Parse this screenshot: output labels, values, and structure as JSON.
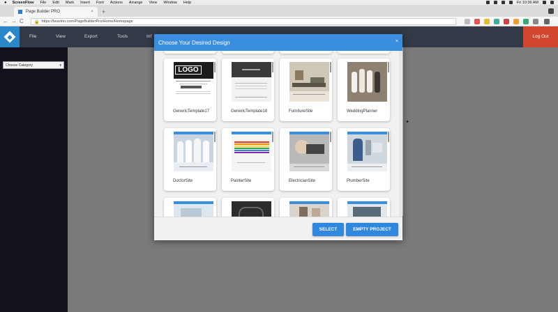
{
  "mac_menubar": {
    "apple": "",
    "app": "ScreenFlow",
    "items": [
      "File",
      "Edit",
      "Mark",
      "Insert",
      "Font",
      "Actions",
      "Arrange",
      "View",
      "Window",
      "Help"
    ],
    "clock": "Fri 10:36 AM"
  },
  "browser": {
    "tab_title": "Page Builder PRO",
    "tab_close": "×",
    "new_tab": "+",
    "back": "←",
    "forward": "→",
    "reload": "C",
    "lock": "🔒",
    "url": "https://bravinn.com/PageBuilderPro/Home/Homepage"
  },
  "app_header": {
    "menu": [
      "File",
      "View",
      "Export",
      "Tools",
      "Inf"
    ],
    "logout": "Log Out"
  },
  "sidebar": {
    "category_value": "Choose Category",
    "caret": "▾"
  },
  "modal": {
    "title": "Choose Your Desired Design",
    "close": "×",
    "cards": [
      {
        "label": "GenericTemplate17"
      },
      {
        "label": "GenericTemplate18"
      },
      {
        "label": "FurnitureSite"
      },
      {
        "label": "WeddingPlanner"
      },
      {
        "label": "DoctorSite"
      },
      {
        "label": "PainterSite"
      },
      {
        "label": "ElectricianSite"
      },
      {
        "label": "PlumberSite"
      }
    ],
    "select_label": "SELECT",
    "empty_label": "EMPTY PROJECT"
  },
  "thumb_logo": "LOGO",
  "colors": {
    "accent": "#3a8ee0",
    "header_bg": "#313a46",
    "logout_bg": "#d0462f",
    "sidebar_bg": "#11121c"
  }
}
